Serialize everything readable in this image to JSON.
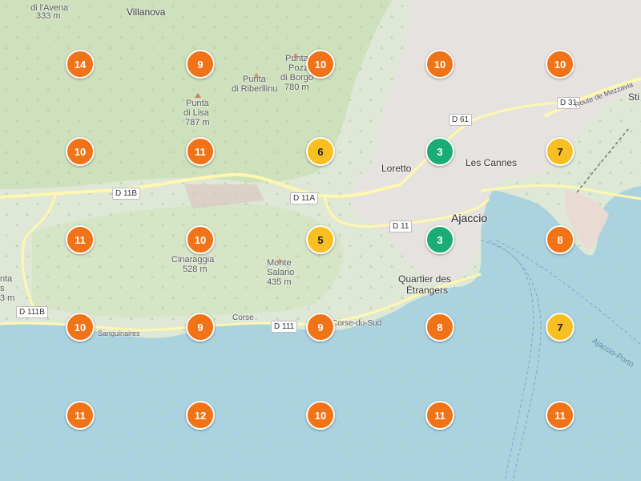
{
  "colors": {
    "sea": "#aad3df",
    "land": "#dfe8d6",
    "forest": "#cfe0bc",
    "urban": "#e8e4e2",
    "road_major": "#fdf8c8",
    "cluster_high": "#f07318",
    "cluster_mid": "#f7bf22",
    "cluster_low": "#1aab76"
  },
  "places": [
    {
      "id": "davena",
      "text": "di l'Avena"
    },
    {
      "id": "davena-ele",
      "text": "333 m"
    },
    {
      "id": "villanova",
      "text": "Villanova"
    },
    {
      "id": "pozzo1",
      "text": "Punta"
    },
    {
      "id": "pozzo2",
      "text": "Pozzo"
    },
    {
      "id": "pozzo3",
      "text": "di Borgo"
    },
    {
      "id": "pozzo4",
      "text": "780 m"
    },
    {
      "id": "riberl1",
      "text": "Punta"
    },
    {
      "id": "riberl2",
      "text": "di Riberllinu"
    },
    {
      "id": "lisa1",
      "text": "Punta"
    },
    {
      "id": "lisa2",
      "text": "di Lisa"
    },
    {
      "id": "lisa3",
      "text": "787 m"
    },
    {
      "id": "loretto",
      "text": "Loretto"
    },
    {
      "id": "lescannes",
      "text": "Les Cannes"
    },
    {
      "id": "ajaccio",
      "text": "Ajaccio"
    },
    {
      "id": "quartier1",
      "text": "Quartier des"
    },
    {
      "id": "quartier2",
      "text": "Étrangers"
    },
    {
      "id": "cinar1",
      "text": "Cinaraggia"
    },
    {
      "id": "cinar2",
      "text": "528 m"
    },
    {
      "id": "salario1",
      "text": "Monte"
    },
    {
      "id": "salario2",
      "text": "Salario"
    },
    {
      "id": "salario3",
      "text": "435 m"
    },
    {
      "id": "corse",
      "text": "Corse"
    },
    {
      "id": "corsedusud",
      "text": "Corse-du-Sud"
    },
    {
      "id": "sangui",
      "text": "Sanguinaires"
    },
    {
      "id": "sti",
      "text": "Sti"
    },
    {
      "id": "lnta1",
      "text": "nta"
    },
    {
      "id": "lnta2",
      "text": "s"
    },
    {
      "id": "lnta3",
      "text": "3 m"
    }
  ],
  "roads": [
    {
      "id": "d11b",
      "text": "D 11B"
    },
    {
      "id": "d11a",
      "text": "D 11A"
    },
    {
      "id": "d11",
      "text": "D 11"
    },
    {
      "id": "d61",
      "text": "D 61"
    },
    {
      "id": "d31",
      "text": "D 31"
    },
    {
      "id": "d111",
      "text": "D 111"
    },
    {
      "id": "d111b",
      "text": "D 111B"
    }
  ],
  "road_names": [
    {
      "id": "mezzavia",
      "text": "Route de Mezzavia"
    }
  ],
  "sea_labels": [
    {
      "id": "ajaccio-porto",
      "text": "Ajaccio-Porto"
    }
  ],
  "clusters": [
    {
      "count": 14,
      "level": "high"
    },
    {
      "count": 9,
      "level": "high"
    },
    {
      "count": 10,
      "level": "high"
    },
    {
      "count": 10,
      "level": "high"
    },
    {
      "count": 10,
      "level": "high"
    },
    {
      "count": 10,
      "level": "high"
    },
    {
      "count": 11,
      "level": "high"
    },
    {
      "count": 6,
      "level": "mid"
    },
    {
      "count": 3,
      "level": "low"
    },
    {
      "count": 7,
      "level": "mid"
    },
    {
      "count": 11,
      "level": "high"
    },
    {
      "count": 10,
      "level": "high"
    },
    {
      "count": 5,
      "level": "mid"
    },
    {
      "count": 3,
      "level": "low"
    },
    {
      "count": 8,
      "level": "high"
    },
    {
      "count": 10,
      "level": "high"
    },
    {
      "count": 9,
      "level": "high"
    },
    {
      "count": 9,
      "level": "high"
    },
    {
      "count": 8,
      "level": "high"
    },
    {
      "count": 7,
      "level": "mid"
    },
    {
      "count": 11,
      "level": "high"
    },
    {
      "count": 12,
      "level": "high"
    },
    {
      "count": 10,
      "level": "high"
    },
    {
      "count": 11,
      "level": "high"
    },
    {
      "count": 11,
      "level": "high"
    }
  ]
}
